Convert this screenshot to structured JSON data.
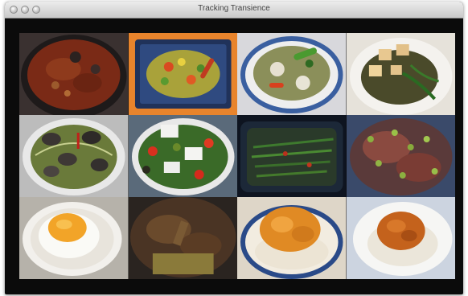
{
  "window": {
    "title": "Tracking Transience"
  },
  "icons": {
    "close": "close-button-icon",
    "minimize": "minimize-button-icon",
    "zoom": "zoom-button-icon"
  },
  "grid": {
    "tiles": [
      "stew-bowl-photo",
      "stir-fry-on-blue-plate-photo",
      "vegetable-bowl-photo",
      "tofu-greens-photo",
      "clams-noodles-photo",
      "salad-photo",
      "beans-in-dark-dish-photo",
      "peas-and-meat-photo",
      "fried-egg-photo",
      "dark-stew-photo",
      "curry-rice-photo",
      "curry-rice-white-plate-photo"
    ]
  }
}
